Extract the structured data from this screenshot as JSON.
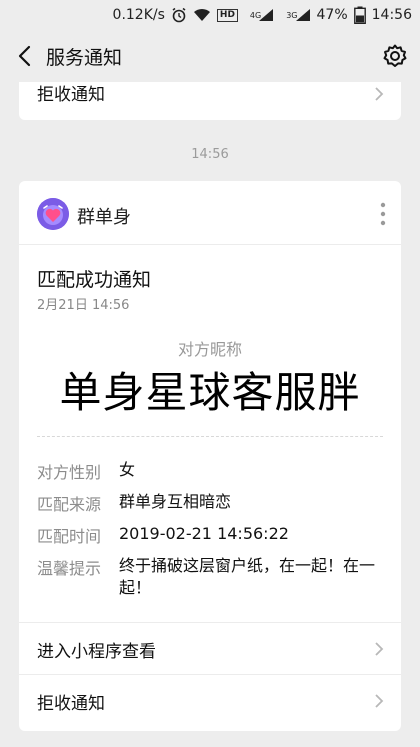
{
  "status_bar": {
    "net_speed": "0.12K/s",
    "hd": "HD",
    "net1": "4G",
    "net2": "3G",
    "battery": "47%",
    "time": "14:56"
  },
  "nav": {
    "title": "服务通知"
  },
  "previous_card": {
    "action_label": "拒收通知"
  },
  "time_separator": "14:56",
  "card": {
    "app_name": "群单身",
    "title": "匹配成功通知",
    "date": "2月21日  14:56",
    "nickname_label": "对方昵称",
    "nickname_value": "单身星球客服胖",
    "fields": [
      {
        "label": "对方性别",
        "value": "女"
      },
      {
        "label": "匹配来源",
        "value": "群单身互相暗恋"
      },
      {
        "label": "匹配时间",
        "value": "2019-02-21 14:56:22"
      },
      {
        "label": "温馨提示",
        "value": "终于捅破这层窗户纸，在一起！在一起！"
      }
    ],
    "actions": [
      {
        "label": "进入小程序查看"
      },
      {
        "label": "拒收通知"
      }
    ]
  },
  "icons": {
    "back": "back-arrow-icon",
    "settings": "gear-icon",
    "more": "more-vertical-icon",
    "chevron": "chevron-right-icon",
    "avatar": "heart-app-logo"
  },
  "colors": {
    "background": "#ededed",
    "card": "#ffffff",
    "avatar": "#7b5ce6",
    "muted_text": "#8c8c8c"
  }
}
